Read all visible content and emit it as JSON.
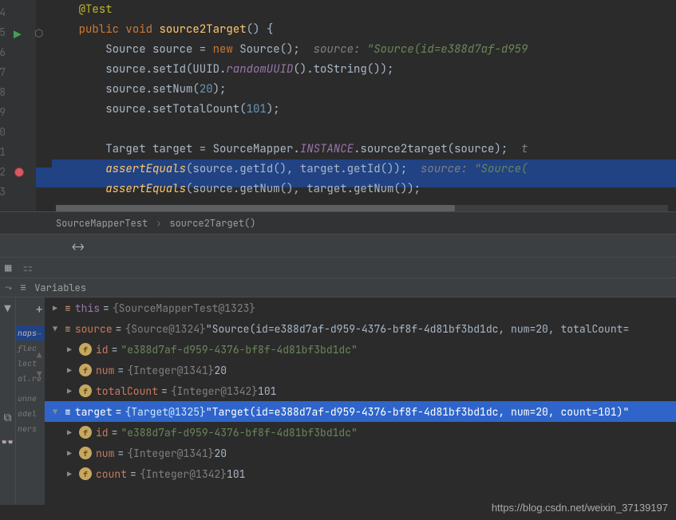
{
  "editor": {
    "lines": [
      "4",
      "5",
      "6",
      "7",
      "8",
      "9",
      "0",
      "1",
      "2",
      "3"
    ],
    "code": {
      "annotation": "@Test",
      "keywords": {
        "public": "public",
        "void": "void",
        "new": "new"
      },
      "method_name": "source2Target",
      "source_decl": "Source source = ",
      "source_ctor": "Source",
      "setId": "source.setId(UUID.",
      "randomUUID": "randomUUID",
      "toString": "().toString());",
      "setNum": "source.setNum(",
      "num_val": "20",
      "setTotal": "source.setTotalCount(",
      "total_val": "101",
      "target_decl": "Target target = SourceMapper.",
      "instance": "INSTANCE",
      "s2t": ".source2target(source);",
      "assert1": "assertEquals",
      "assert1_args": "(source.getId(), target.getId());",
      "assert2": "assertEquals",
      "assert2_args": "(source.getNum(), target.getNum());",
      "hint_source": "source: ",
      "hint_source_val": "\"Source(id=e388d7af-d959",
      "hint_t": "t",
      "hint_source2": "\"Source("
    }
  },
  "breadcrumb": {
    "class": "SourceMapperTest",
    "method": "source2Target()"
  },
  "variables": {
    "header": "Variables",
    "this": {
      "name": "this",
      "ref": "{SourceMapperTest@1323}"
    },
    "source": {
      "name": "source",
      "ref": "{Source@1324}",
      "val": "\"Source(id=e388d7af-d959-4376-bf8f-4d81bf3bd1dc, num=20, totalCount="
    },
    "source_id": {
      "name": "id",
      "val": "\"e388d7af-d959-4376-bf8f-4d81bf3bd1dc\""
    },
    "source_num": {
      "name": "num",
      "ref": "{Integer@1341}",
      "val": "20"
    },
    "source_total": {
      "name": "totalCount",
      "ref": "{Integer@1342}",
      "val": "101"
    },
    "target": {
      "name": "target",
      "ref": "{Target@1325}",
      "val": "\"Target(id=e388d7af-d959-4376-bf8f-4d81bf3bd1dc, num=20, count=101)\""
    },
    "target_id": {
      "name": "id",
      "val": "\"e388d7af-d959-4376-bf8f-4d81bf3bd1dc\""
    },
    "target_num": {
      "name": "num",
      "ref": "{Integer@1341}",
      "val": "20"
    },
    "target_count": {
      "name": "count",
      "ref": "{Integer@1342}",
      "val": "101"
    }
  },
  "frames": [
    "naps",
    "flec",
    "lect",
    "al.re",
    "",
    "unne",
    "odel",
    "ners"
  ],
  "watermark": "https://blog.csdn.net/weixin_37139197"
}
